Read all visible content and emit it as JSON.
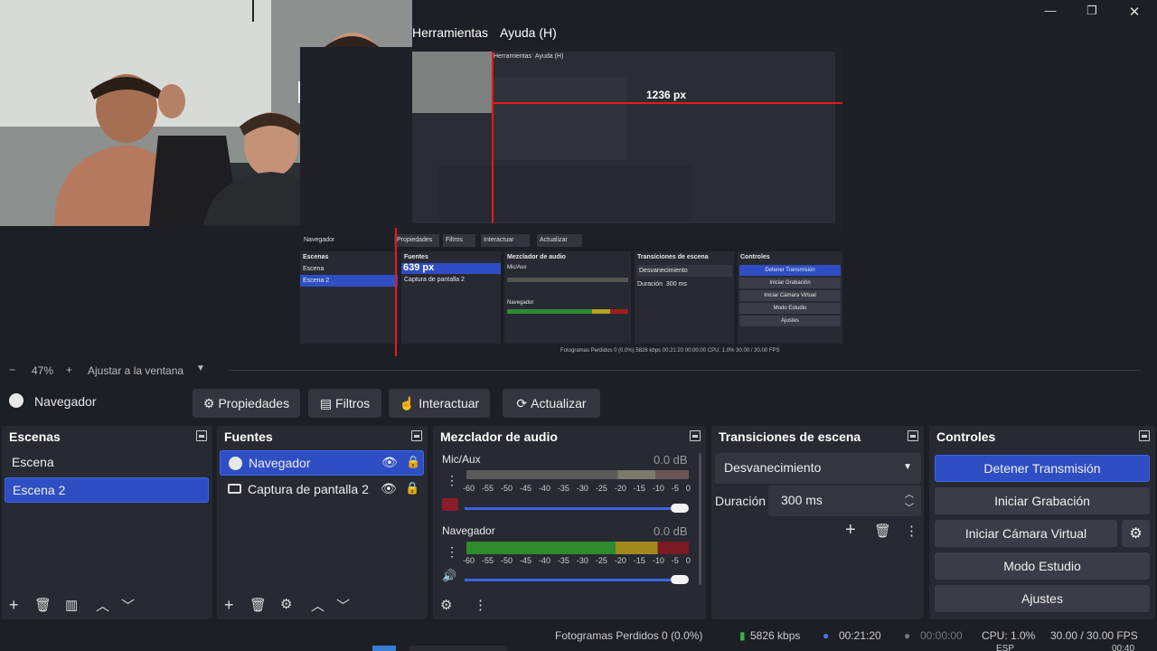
{
  "menu": {
    "tools": "Herramientas",
    "help": "Ayuda (H)"
  },
  "window_controls": {
    "minimize": "—",
    "maximize": "❐",
    "close": "✕"
  },
  "preview": {
    "width_label": "1236 px",
    "height_label": "639 px",
    "inner": {
      "menu_tools": "Herramientas",
      "menu_help": "Ayuda (H)",
      "source_name": "Navegador",
      "btn_props": "Propiedades",
      "btn_filters": "Filtros",
      "btn_interact": "Interactuar",
      "btn_refresh": "Actualizar",
      "docks": {
        "scenes": "Escenas",
        "sources": "Fuentes",
        "mixer": "Mezclador de audio",
        "transitions": "Transiciones de escena",
        "controls": "Controles"
      },
      "scene1": "Escena",
      "scene2": "Escena 2",
      "src2": "Captura de pantalla 2",
      "mic": "Mic/Aux",
      "nav": "Navegador",
      "db": "0.0 dB",
      "fade": "Desvanecimiento",
      "duration": "Duración",
      "ms": "300 ms",
      "stop": "Detener Transmisión",
      "rec": "Iniciar Grabación",
      "vcam": "Iniciar Cámara Virtual",
      "studio": "Modo Estudio",
      "settings": "Ajustes",
      "status": "Fotogramas Perdidos 0 (0.0%)   5826 kbps   00:21:20   00:00:00   CPU: 1.0%   30.00 / 30.00 FPS"
    }
  },
  "zoom": {
    "minus": "−",
    "value": "47%",
    "plus": "+",
    "fit": "Ajustar a la ventana"
  },
  "source_toolbar": {
    "name": "Navegador",
    "properties": "Propiedades",
    "filters": "Filtros",
    "interact": "Interactuar",
    "refresh": "Actualizar"
  },
  "scenes": {
    "title": "Escenas",
    "items": [
      "Escena",
      "Escena 2"
    ],
    "selected": 1
  },
  "sources": {
    "title": "Fuentes",
    "items": [
      "Navegador",
      "Captura de pantalla 2"
    ],
    "selected": 0
  },
  "mixer": {
    "title": "Mezclador de audio",
    "channels": [
      {
        "name": "Mic/Aux",
        "db": "0.0 dB",
        "muted": true,
        "level": 0
      },
      {
        "name": "Navegador",
        "db": "0.0 dB",
        "muted": false,
        "level": 1
      }
    ],
    "scale": [
      "-60",
      "-55",
      "-50",
      "-45",
      "-40",
      "-35",
      "-30",
      "-25",
      "-20",
      "-15",
      "-10",
      "-5",
      "0"
    ]
  },
  "transitions": {
    "title": "Transiciones de escena",
    "selected": "Desvanecimiento",
    "duration_label": "Duración",
    "duration": "300 ms"
  },
  "controls": {
    "title": "Controles",
    "stop_stream": "Detener Transmisión",
    "start_recording": "Iniciar Grabación",
    "start_vcam": "Iniciar Cámara Virtual",
    "studio_mode": "Modo Estudio",
    "settings": "Ajustes"
  },
  "status": {
    "dropped": "Fotogramas Perdidos 0 (0.0%)",
    "bitrate": "5826 kbps",
    "stream_time": "00:21:20",
    "rec_time": "00:00:00",
    "cpu": "CPU: 1.0%",
    "fps": "30.00 / 30.00 FPS"
  },
  "taskbar": {
    "lang": "ESP",
    "time": "00:40"
  },
  "colors": {
    "accent": "#2f4ec3",
    "meter_green": "#2e8b2e",
    "meter_yellow": "#b8a31f",
    "meter_red": "#9c1d1d",
    "red_guide": "#e31a1a"
  }
}
